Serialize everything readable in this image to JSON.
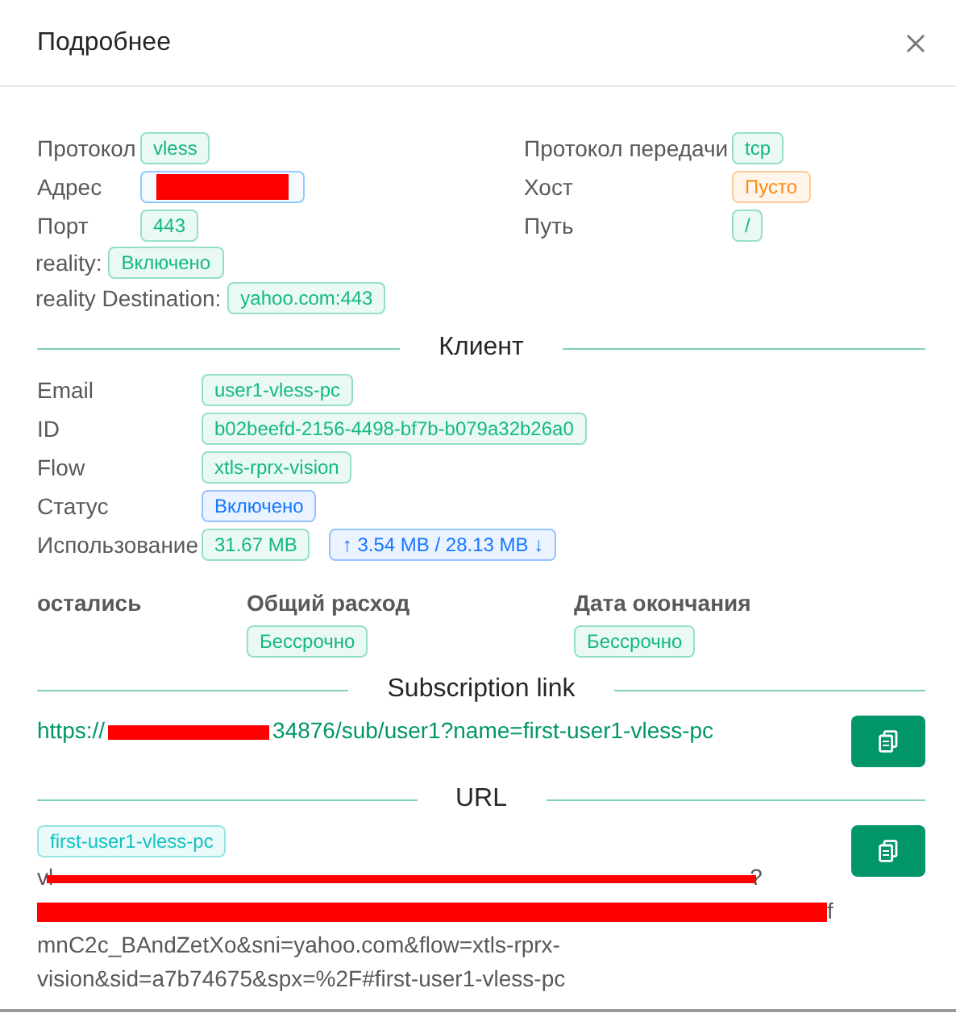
{
  "title": "Подробнее",
  "inbound": {
    "left": [
      {
        "label": "Протокол",
        "tag": {
          "text": "vless",
          "color": "#14b885"
        }
      },
      {
        "label": "Адрес",
        "tag": {
          "redacted": true,
          "color": "#91caff"
        }
      },
      {
        "label": "Порт",
        "tag": {
          "text": "443",
          "color": "#14b885"
        }
      }
    ],
    "right": [
      {
        "label": "Протокол передачи",
        "tag": {
          "text": "tcp",
          "color": "#14b885"
        }
      },
      {
        "label": "Хост",
        "tag": {
          "text": "Пусто",
          "color": "#fa8c16"
        }
      },
      {
        "label": "Путь",
        "tag": {
          "text": "/",
          "color": "#14b885"
        }
      }
    ],
    "inline": [
      {
        "label": "reality:",
        "tag": {
          "text": "Включено",
          "color": "#14b885"
        }
      },
      {
        "label": "reality Destination:",
        "tag": {
          "text": "yahoo.com:443",
          "color": "#14b885"
        }
      }
    ]
  },
  "client": {
    "title": "Клиент",
    "rows": [
      {
        "label": "Email",
        "tags": [
          {
            "text": "user1-vless-pc",
            "color": "#14b885"
          }
        ]
      },
      {
        "label": "ID",
        "tags": [
          {
            "text": "b02beefd-2156-4498-bf7b-b079a32b26a0",
            "color": "#14b885"
          }
        ]
      },
      {
        "label": "Flow",
        "tags": [
          {
            "text": "xtls-rprx-vision",
            "color": "#14b885"
          }
        ]
      },
      {
        "label": "Статус",
        "tags": [
          {
            "text": "Включено",
            "color": "#1677ff"
          }
        ]
      },
      {
        "label": "Использование",
        "tags": [
          {
            "text": "31.67 MB",
            "color": "#14b885"
          },
          {
            "text": "↑ 3.54 MB / 28.13 MB ↓",
            "color": "#1677ff"
          }
        ]
      }
    ],
    "stats": [
      {
        "heading": "остались"
      },
      {
        "heading": "Общий расход",
        "tag": {
          "text": "Бессрочно",
          "color": "#14b885"
        }
      },
      {
        "heading": "Дата окончания",
        "tag": {
          "text": "Бессрочно",
          "color": "#14b885"
        }
      }
    ]
  },
  "subscription": {
    "title": "Subscription link",
    "link": [
      {
        "kind": "text",
        "text": "https://"
      },
      {
        "kind": "redacted"
      },
      {
        "kind": "text",
        "text": "34876/sub/user1?name=first-user1-vless-pc"
      }
    ]
  },
  "url": {
    "title": "URL",
    "tag": {
      "text": "first-user1-vless-pc",
      "color": "#13c2c2"
    },
    "lines": [
      [
        {
          "kind": "text",
          "text": "vl"
        },
        {
          "kind": "redacted"
        },
        {
          "kind": "text",
          "text": "?"
        }
      ],
      [
        {
          "kind": "redacted"
        },
        {
          "kind": "text",
          "text": "f"
        }
      ],
      [
        {
          "kind": "text",
          "text": "mnC2c_BAndZetXo&sni=yahoo.com&flow=xtls-rprx-"
        }
      ],
      [
        {
          "kind": "text",
          "text": "vision&sid=a7b74675&spx=%2F#first-user1-vless-pc"
        }
      ]
    ]
  }
}
